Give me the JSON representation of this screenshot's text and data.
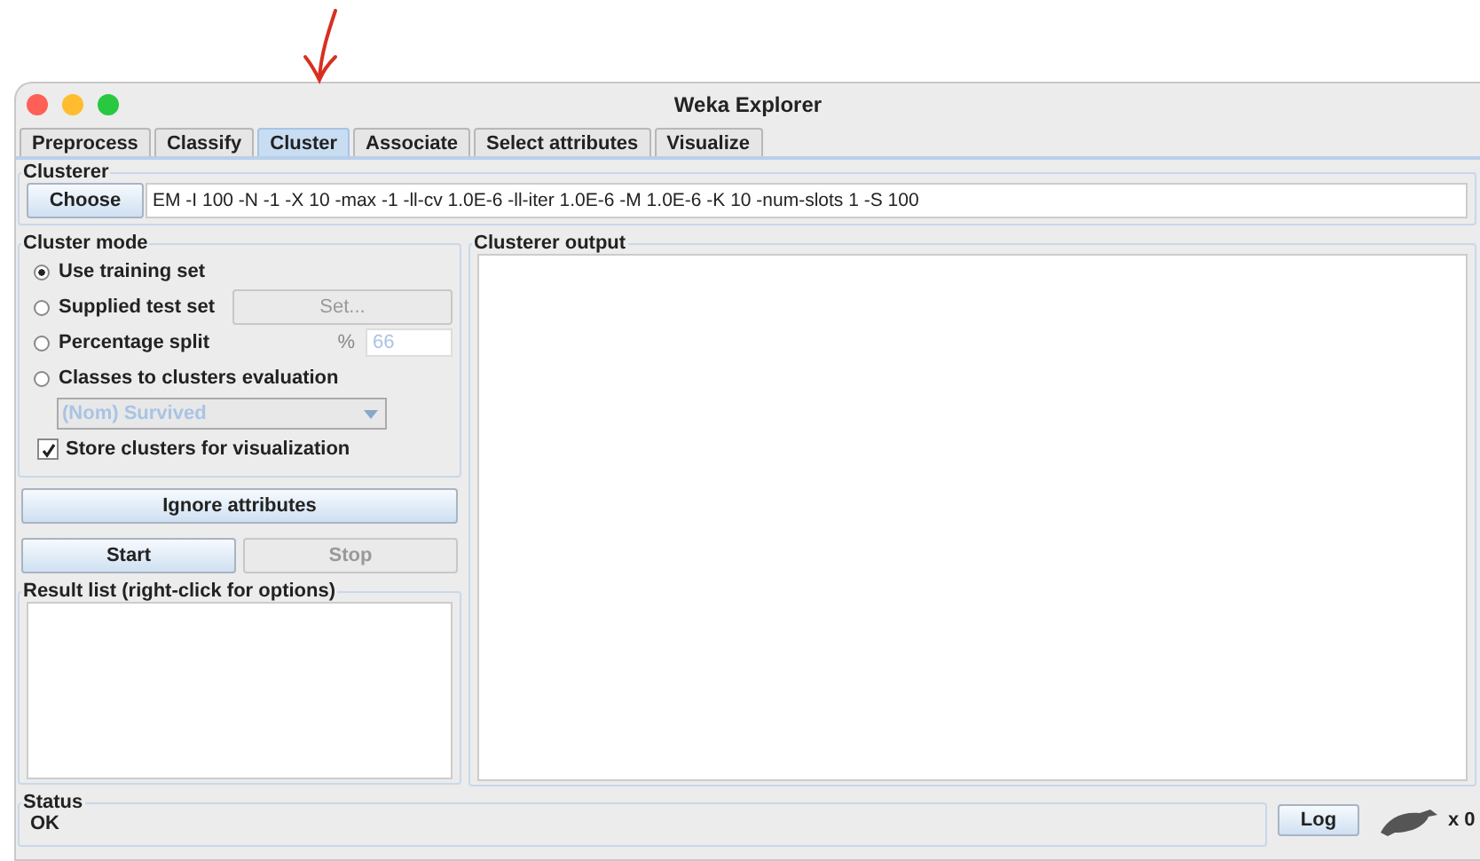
{
  "window": {
    "title": "Weka Explorer"
  },
  "tabs": [
    {
      "label": "Preprocess",
      "selected": false
    },
    {
      "label": "Classify",
      "selected": false
    },
    {
      "label": "Cluster",
      "selected": true
    },
    {
      "label": "Associate",
      "selected": false
    },
    {
      "label": "Select attributes",
      "selected": false
    },
    {
      "label": "Visualize",
      "selected": false
    }
  ],
  "clusterer": {
    "title": "Clusterer",
    "button": "Choose",
    "command": "EM -I 100 -N -1 -X 10 -max -1 -ll-cv 1.0E-6 -ll-iter 1.0E-6 -M 1.0E-6 -K 10 -num-slots 1 -S 100"
  },
  "cluster_mode": {
    "title": "Cluster mode",
    "options": [
      {
        "kind": "plain",
        "label": "Use training set",
        "selected": true
      },
      {
        "kind": "button",
        "label": "Supplied test set",
        "selected": false,
        "button": {
          "label": "Set...",
          "disabled": true
        }
      },
      {
        "kind": "percent",
        "label": "Percentage split",
        "selected": false,
        "sign": "%",
        "value": "66",
        "disabled": true
      },
      {
        "kind": "plain",
        "label": "Classes to clusters evaluation",
        "selected": false
      }
    ],
    "dropdown": {
      "value": "(Nom) Survived",
      "disabled": true
    },
    "checkbox": {
      "label": "Store clusters for visualization",
      "checked": true
    }
  },
  "buttons": [
    {
      "label": "Ignore attributes",
      "disabled": false
    },
    {
      "label": "Start",
      "disabled": false
    },
    {
      "label": "Stop",
      "disabled": true
    }
  ],
  "result_list": {
    "title": "Result list (right-click for options)"
  },
  "output": {
    "title": "Clusterer output"
  },
  "status": {
    "title": "Status",
    "text": "OK",
    "button": "Log",
    "count": "x 0"
  }
}
